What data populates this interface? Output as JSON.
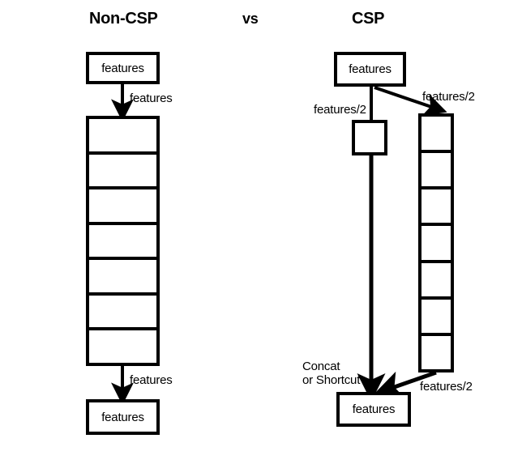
{
  "diagram": {
    "titles": {
      "left": "Non-CSP",
      "middle": "vs",
      "right": "CSP"
    },
    "colors": {
      "stroke": "#000000",
      "fill": "#ffffff",
      "text": "#000000"
    },
    "left_column": {
      "input_box_label": "features",
      "input_arrow_label": "features",
      "stack_cell_count": 7,
      "output_arrow_label": "features",
      "output_box_label": "features"
    },
    "right_column": {
      "input_box_label": "features",
      "split_left_label": "features/2",
      "split_right_label": "features/2",
      "small_box_label": "",
      "stack_cell_count": 7,
      "merge_label_line1": "Concat",
      "merge_label_line2": "or Shortcut",
      "merge_right_label": "features/2",
      "output_box_label": "features"
    }
  }
}
